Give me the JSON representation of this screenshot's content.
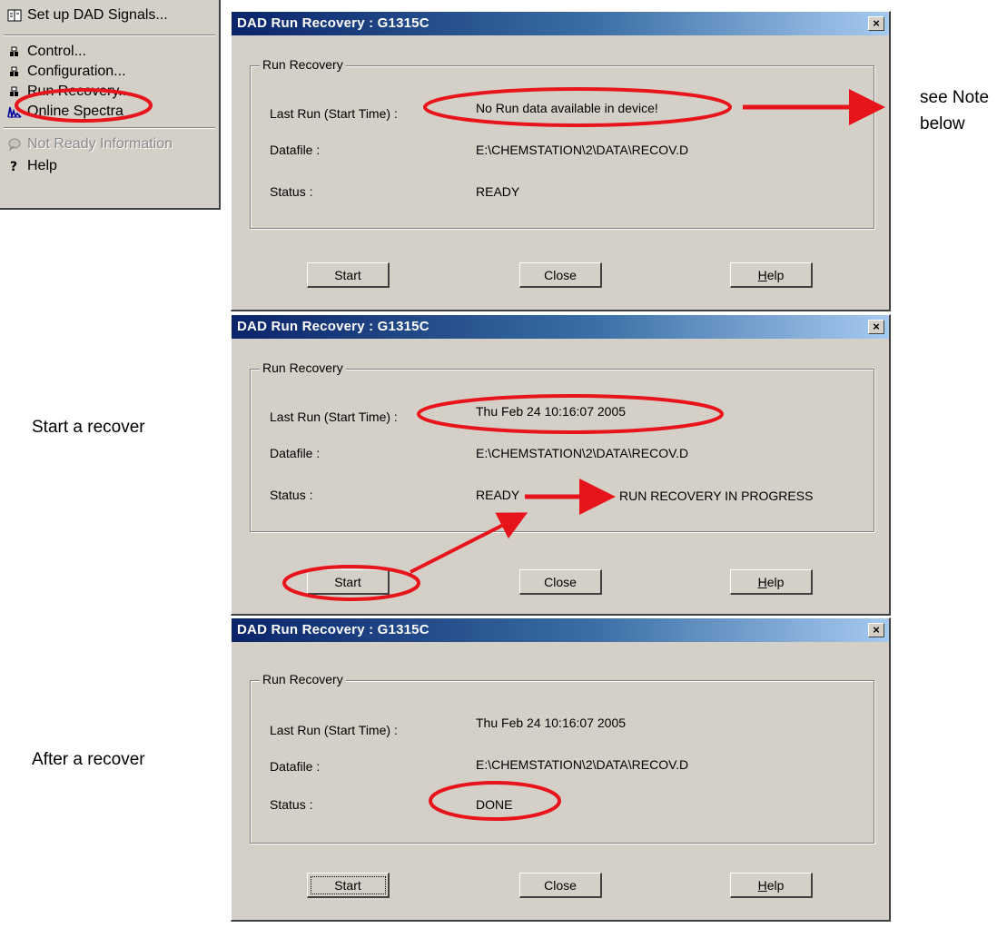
{
  "menu": {
    "items": [
      {
        "label": "Set up DAD Signals...",
        "icon": "signals-icon"
      },
      {
        "label": "Control...",
        "icon": "control-icon"
      },
      {
        "label": "Configuration...",
        "icon": "configuration-icon"
      },
      {
        "label": "Run Recovery...",
        "icon": "run-recovery-icon"
      },
      {
        "label": "Online Spectra",
        "icon": "spectra-icon"
      },
      {
        "label": "Not Ready Information",
        "icon": "info-icon",
        "disabled": true
      },
      {
        "label": "Help",
        "icon": "help-icon"
      }
    ]
  },
  "dialogs": [
    {
      "title": "DAD Run Recovery : G1315C",
      "group_label": "Run Recovery",
      "fields": [
        {
          "label": "Last Run (Start Time) :",
          "value": "No Run data available in device!"
        },
        {
          "label": "Datafile :",
          "value": "E:\\CHEMSTATION\\2\\DATA\\RECOV.D"
        },
        {
          "label": "Status :",
          "value": "READY"
        }
      ],
      "buttons": {
        "start": "Start",
        "close": "Close",
        "help_pre": "",
        "help_u": "H",
        "help_post": "elp"
      }
    },
    {
      "title": "DAD Run Recovery : G1315C",
      "group_label": "Run Recovery",
      "fields": [
        {
          "label": "Last Run (Start Time) :",
          "value": "Thu Feb 24 10:16:07 2005"
        },
        {
          "label": "Datafile :",
          "value": "E:\\CHEMSTATION\\2\\DATA\\RECOV.D"
        },
        {
          "label": "Status :",
          "value": "READY"
        }
      ],
      "buttons": {
        "start": "Start",
        "close": "Close",
        "help_pre": "",
        "help_u": "H",
        "help_post": "elp"
      }
    },
    {
      "title": "DAD Run Recovery : G1315C",
      "group_label": "Run Recovery",
      "fields": [
        {
          "label": "Last Run (Start Time) :",
          "value": "Thu Feb 24 10:16:07 2005"
        },
        {
          "label": "Datafile :",
          "value": "E:\\CHEMSTATION\\2\\DATA\\RECOV.D"
        },
        {
          "label": "Status :",
          "value": "DONE"
        }
      ],
      "buttons": {
        "start": "Start",
        "close": "Close",
        "help_pre": "",
        "help_u": "H",
        "help_post": "elp"
      }
    }
  ],
  "annotations": {
    "note_line1": "see Note",
    "note_line2": "below",
    "start_recover": "Start a recover",
    "after_recover": "After a recover",
    "progress_status": "RUN RECOVERY IN PROGRESS"
  },
  "colors": {
    "highlight": "#e8141c",
    "title_start": "#0a246a",
    "title_end": "#a6caf0",
    "dialog_bg": "#d4d0c8"
  }
}
